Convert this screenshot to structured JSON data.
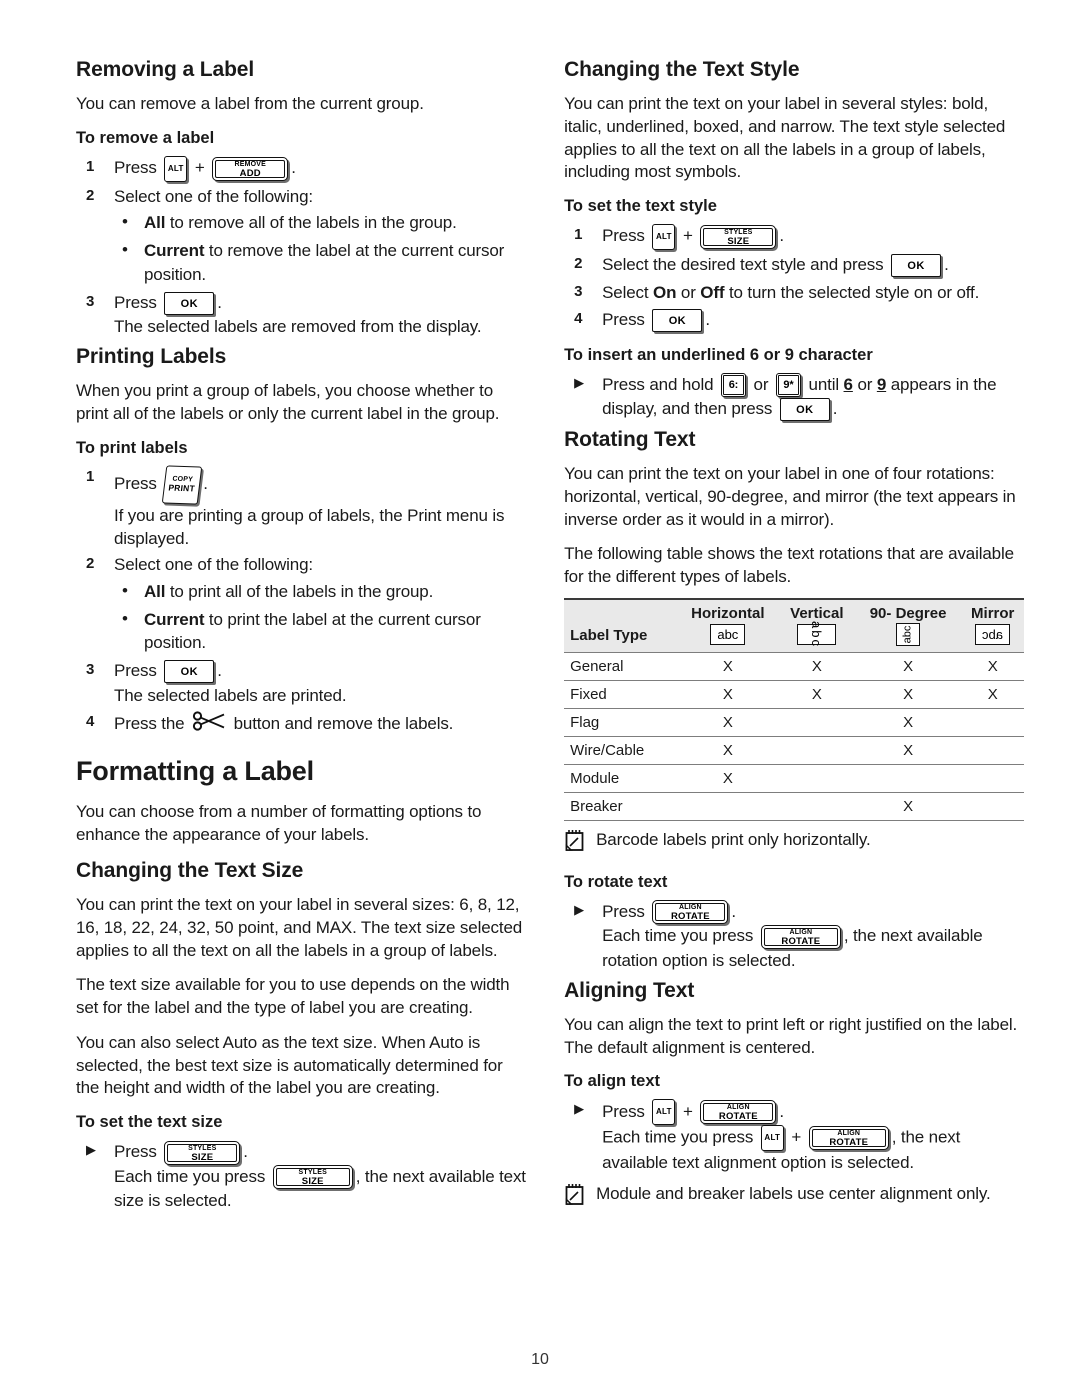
{
  "page": {
    "number": "10"
  },
  "left_column": {
    "removing": {
      "heading": "Removing a Label",
      "intro": "You can remove a label from the current group.",
      "task": "To remove a label",
      "step1_press": "Press",
      "step1_plus": "+",
      "step1_period": ".",
      "step2": "Select one of the following:",
      "bullet1_bold": "All",
      "bullet1_rest": " to remove all of the labels in the group.",
      "bullet2_bold": "Current",
      "bullet2_rest": " to remove the label at the current cursor position.",
      "step3_press": "Press",
      "step3_period": ".",
      "step3_result": "The selected labels are removed from the display."
    },
    "printing": {
      "heading": "Printing Labels",
      "intro": "When you print a group of labels, you choose whether to print all of the labels or only the current label in the group.",
      "task": "To print labels",
      "step1_press": "Press",
      "step1_period": ".",
      "step1_result": "If you are printing a group of labels, the Print menu is displayed.",
      "step2": "Select one of the following:",
      "bullet1_bold": "All",
      "bullet1_rest": " to print all of the labels in the group.",
      "bullet2_bold": "Current",
      "bullet2_rest": " to print the label at the current cursor position.",
      "step3_press": "Press",
      "step3_period": ".",
      "step3_result": "The selected labels are printed.",
      "step4_pre": "Press the",
      "step4_post": "button and remove the labels."
    },
    "formatting": {
      "heading": "Formatting a Label",
      "intro": "You can choose from a number of formatting options to enhance the appearance of your labels."
    },
    "text_size": {
      "heading": "Changing the Text Size",
      "para1": "You can print the text on your label in several sizes: 6, 8, 12, 16, 18, 22, 24, 32, 50 point, and MAX. The text size selected applies to all the text on all the labels in a group of labels.",
      "para2": "The text size available for you to use depends on the width set for the label and the type of label you are creating.",
      "para3": "You can also select Auto as the text size. When Auto is selected, the best text size is automatically determined for the height and width of the label you are creating.",
      "task": "To set the text size",
      "step_press": "Press",
      "step_period": ".",
      "step_each_pre": "Each time you press",
      "step_each_post": ", the next available text size is selected."
    }
  },
  "right_column": {
    "text_style": {
      "heading": "Changing the Text Style",
      "intro": "You can print the text on your label in several styles: bold, italic, underlined, boxed, and narrow. The text style selected applies to all the text on all the labels in a group of labels, including most symbols.",
      "task": "To set the text style",
      "step1_press": "Press",
      "step1_plus": "+",
      "step1_period": ".",
      "step2_pre": "Select the desired text style and press",
      "step2_period": ".",
      "step3_pre": "Select ",
      "step3_on": "On",
      "step3_mid": " or ",
      "step3_off": "Off",
      "step3_post": " to turn the selected style on or off.",
      "step4_press": "Press",
      "step4_period": ".",
      "task2": "To insert an underlined 6 or 9 character",
      "bullet_pre": "Press and hold",
      "bullet_or": "or",
      "bullet_until": "until",
      "bullet_six": "6",
      "bullet_or2": "or",
      "bullet_nine": "9",
      "bullet_appears": "appears in the display, and then press",
      "bullet_period": "."
    },
    "rotating": {
      "heading": "Rotating Text",
      "para1": "You can print the text on your label in one of four rotations: horizontal, vertical, 90-degree, and mirror (the text appears in inverse order as it would in a mirror).",
      "para2": "The following table shows the text rotations that are available for the different types of labels.",
      "note": "Barcode labels print only horizontally.",
      "task": "To rotate text",
      "step_press": "Press",
      "step_period": ".",
      "step_each_pre": "Each time you press",
      "step_each_post": ", the next available rotation option is selected."
    },
    "aligning": {
      "heading": "Aligning Text",
      "intro": "You can align the text to print left or right justified on the label. The default alignment is centered.",
      "task": "To align text",
      "step_press": "Press",
      "step_plus": "+",
      "step_period": ".",
      "step_each_pre": "Each time you press",
      "step_each_plus": "+",
      "step_each_post": ", the next available text alignment option is selected.",
      "note": "Module and breaker labels use center alignment only."
    }
  },
  "keys": {
    "alt": "ALT",
    "remove": "REMOVE",
    "add": "ADD",
    "ok": "OK",
    "copy": "COPY",
    "print": "PRINT",
    "styles": "STYLES",
    "size": "SIZE",
    "align": "ALIGN",
    "rotate": "ROTATE",
    "six": "6:",
    "nine": "9*"
  },
  "rotation_table": {
    "label_type_header": "Label Type",
    "columns": [
      "Horizontal",
      "Vertical",
      "90- Degree",
      "Mirror"
    ],
    "sample_text": "abc",
    "mark": "X",
    "rows": [
      {
        "type": "General",
        "horizontal": "X",
        "vertical": "X",
        "degree90": "X",
        "mirror": "X"
      },
      {
        "type": "Fixed",
        "horizontal": "X",
        "vertical": "X",
        "degree90": "X",
        "mirror": "X"
      },
      {
        "type": "Flag",
        "horizontal": "X",
        "vertical": "",
        "degree90": "X",
        "mirror": ""
      },
      {
        "type": "Wire/Cable",
        "horizontal": "X",
        "vertical": "",
        "degree90": "X",
        "mirror": ""
      },
      {
        "type": "Module",
        "horizontal": "X",
        "vertical": "",
        "degree90": "",
        "mirror": ""
      },
      {
        "type": "Breaker",
        "horizontal": "",
        "vertical": "",
        "degree90": "X",
        "mirror": ""
      }
    ]
  }
}
